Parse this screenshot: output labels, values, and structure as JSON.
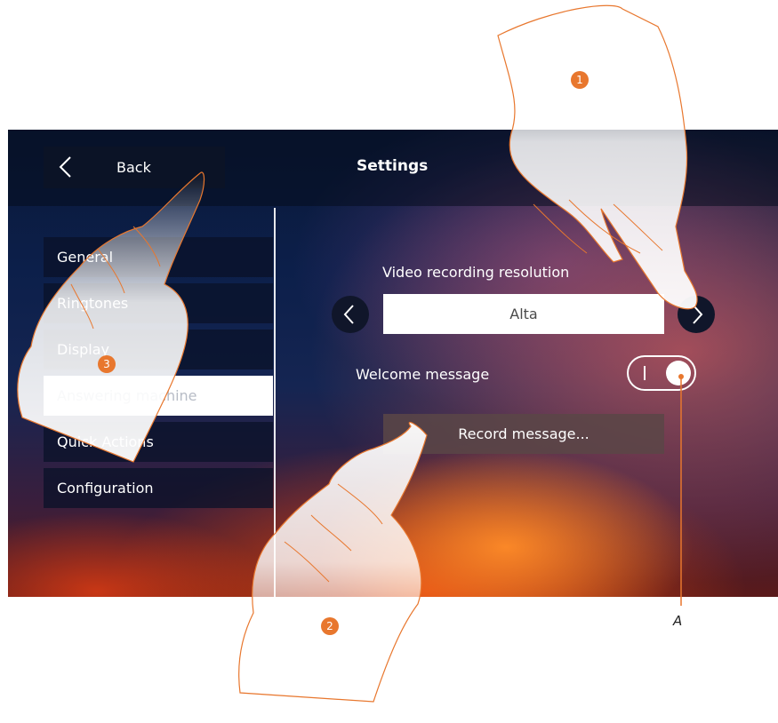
{
  "header": {
    "back_label": "Back",
    "title": "Settings"
  },
  "sidebar": {
    "items": [
      {
        "label": "General"
      },
      {
        "label": "Ringtones"
      },
      {
        "label": "Display"
      },
      {
        "label": "Answering machine",
        "active": true
      },
      {
        "label": "Quick Actions"
      },
      {
        "label": "Configuration"
      }
    ]
  },
  "main": {
    "video_resolution_label": "Video recording resolution",
    "video_resolution_value": "Alta",
    "welcome_label": "Welcome message",
    "welcome_on": true,
    "record_button": "Record message..."
  },
  "annotations": {
    "steps": [
      "1",
      "2",
      "3"
    ],
    "callout": "A"
  },
  "colors": {
    "accent": "#e8772e",
    "panel": "#0b1326"
  }
}
